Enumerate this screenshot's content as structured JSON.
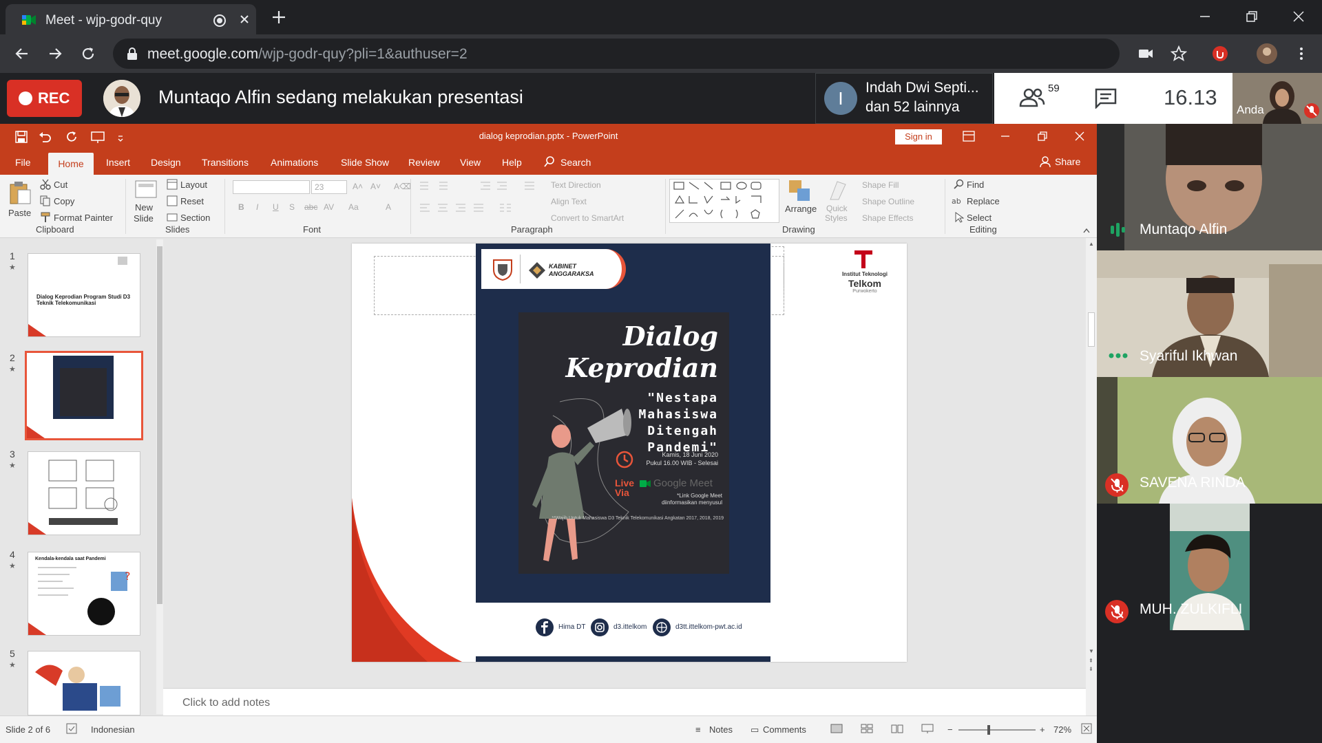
{
  "browser": {
    "tab_title": "Meet - wjp-godr-quy",
    "url_host": "meet.google.com",
    "url_path": "/wjp-godr-quy?pli=1&authuser=2"
  },
  "meet": {
    "rec_label": "REC",
    "presenting_text": "Muntaqo Alfin sedang melakukan presentasi",
    "chat_popup": {
      "initial": "I",
      "line1": "Indah Dwi Septi...",
      "line2": "dan 52 lainnya"
    },
    "people_count": "59",
    "clock": "16.13",
    "self_label": "Anda"
  },
  "ppt": {
    "doc_title": "dialog keprodian.pptx  -  PowerPoint",
    "signin": "Sign in",
    "share": "Share",
    "tabs": [
      "File",
      "Home",
      "Insert",
      "Design",
      "Transitions",
      "Animations",
      "Slide Show",
      "Review",
      "View",
      "Help"
    ],
    "search": "Search",
    "ribbon": {
      "paste": "Paste",
      "cut": "Cut",
      "copy": "Copy",
      "format_painter": "Format Painter",
      "new_slide_1": "New",
      "new_slide_2": "Slide",
      "layout": "Layout",
      "reset": "Reset",
      "section": "Section",
      "font_size": "23",
      "text_direction": "Text Direction",
      "align_text": "Align Text",
      "convert_smartart": "Convert to SmartArt",
      "arrange": "Arrange",
      "quick_styles_1": "Quick",
      "quick_styles_2": "Styles",
      "shape_fill": "Shape Fill",
      "shape_outline": "Shape Outline",
      "shape_effects": "Shape Effects",
      "find": "Find",
      "replace": "Replace",
      "select": "Select",
      "groups": {
        "clipboard": "Clipboard",
        "slides": "Slides",
        "font": "Font",
        "paragraph": "Paragraph",
        "drawing": "Drawing",
        "editing": "Editing"
      }
    },
    "thumbnails": [
      {
        "num": "1",
        "text": "Dialog Keprodian Program Studi D3 Teknik Telekomunikasi"
      },
      {
        "num": "2",
        "text": ""
      },
      {
        "num": "3",
        "text": ""
      },
      {
        "num": "4",
        "text": "Kendala-kendala saat Pandemi"
      },
      {
        "num": "5",
        "text": ""
      }
    ],
    "slide": {
      "poster_org1": "KABINET",
      "poster_org2": "ANGGARAKSA",
      "logo_text1": "Institut Teknologi",
      "logo_text2": "Telkom",
      "logo_text3": "Purwokerto",
      "title1": "Dialog",
      "title2": "Keprodian",
      "quote1": "\"Nestapa",
      "quote2": "Mahasiswa",
      "quote3": "Ditengah",
      "quote4": "Pandemi\"",
      "date": "Kamis, 18 Juni 2020",
      "time": "Pukul 16.00 WIB - Selesai",
      "live1": "Live",
      "live2": "Via",
      "platform": "Google Meet",
      "link_note1": "*Link Google Meet",
      "link_note2": "diinformasikan menyusul",
      "mandatory": "**Wajib Untuk Mahasiswa D3 Teknik Telekomunikasi Angkatan 2017, 2018, 2019",
      "social1": "Hima DT",
      "social2": "d3.ittelkom",
      "social3": "d3tt.ittelkom-pwt.ac.id"
    },
    "notes_placeholder": "Click to add notes",
    "status": {
      "slide_of": "Slide 2 of 6",
      "language": "Indonesian",
      "notes": "Notes",
      "comments": "Comments",
      "zoom": "72%"
    }
  },
  "participants": [
    {
      "name": "Muntaqo Alfin",
      "state": "speaking"
    },
    {
      "name": "Syariful Ikhwan",
      "state": "active"
    },
    {
      "name": "SAVENA RINDA",
      "state": "muted"
    },
    {
      "name": "MUH. ZULKIFLI",
      "state": "muted"
    }
  ]
}
